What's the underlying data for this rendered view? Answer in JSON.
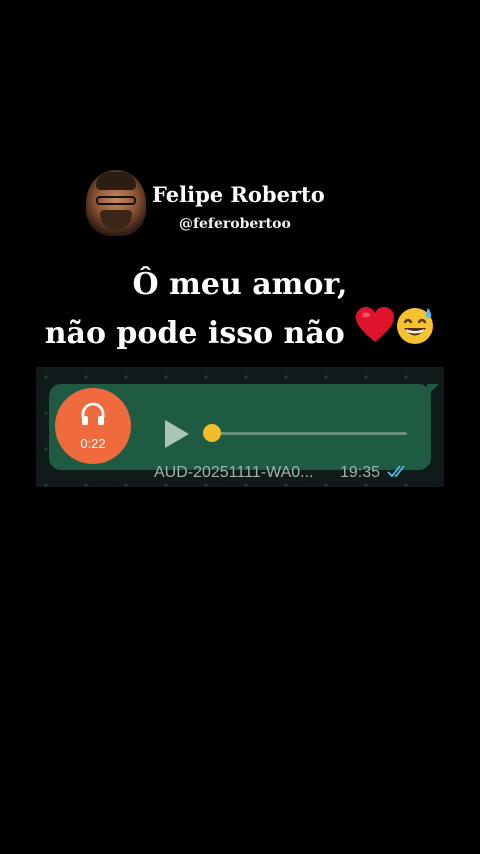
{
  "profile": {
    "name": "Felipe Roberto",
    "handle": "@feferobertoo"
  },
  "caption": {
    "line1": "Ô meu amor,",
    "line2": "não pode isso não",
    "emojis": [
      "red-heart",
      "grinning-face-with-sweat"
    ]
  },
  "voice_message": {
    "duration": "0:22",
    "filename": "AUD-20251111-WA0...",
    "time": "19:35",
    "progress": 0,
    "status": "read",
    "colors": {
      "bubble": "#1f5a42",
      "disc": "#ef6a3c",
      "knob": "#f2bd2a",
      "ticks": "#53bdeb"
    }
  }
}
